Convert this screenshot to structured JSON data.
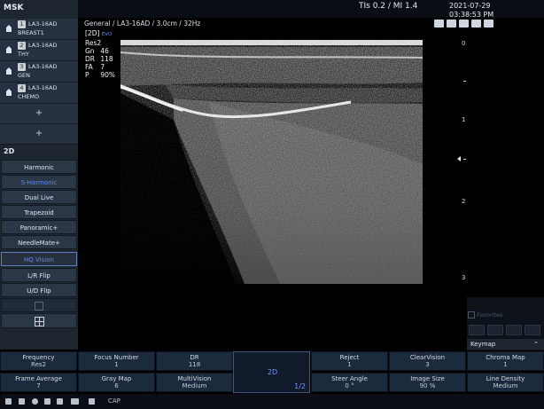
{
  "app_title": "MSK",
  "probes": [
    {
      "num": "1",
      "name": "LA3-16AD",
      "group": "BREAST1"
    },
    {
      "num": "2",
      "name": "LA3-16AD",
      "group": "THY"
    },
    {
      "num": "3",
      "name": "LA3-16AD",
      "group": "GEN"
    },
    {
      "num": "4",
      "name": "LA3-16AD",
      "group": "CHEMO"
    }
  ],
  "plus_label": "+",
  "mode": "2D",
  "mode_buttons": [
    "Harmonic",
    "S-Harmonic",
    "Dual Live",
    "Trapezoid",
    "Panoramic+",
    "NeedleMate+",
    "HQ Vision",
    "L/R Flip",
    "U/D Flip"
  ],
  "status": {
    "index": "TIs 0.2  / MI 1.4",
    "date": "2021-07-29",
    "time": "03:38:53 PM"
  },
  "scan_params": "General / LA3-16AD / 3.0cm / 32Hz",
  "readout": {
    "mode_tag": "[2D]",
    "evo": "EVO",
    "res": "Res2",
    "rows": [
      {
        "k": "Gn",
        "v": "46"
      },
      {
        "k": "DR",
        "v": "118"
      },
      {
        "k": "FA",
        "v": "7"
      },
      {
        "k": "P",
        "v": "90%"
      }
    ]
  },
  "depth_scale": {
    "labels": [
      "0",
      "1",
      "2",
      "3"
    ]
  },
  "favorites_label": "Favorites",
  "keymap_label": "Keymap",
  "bottom_row1": [
    {
      "label": "Frequency",
      "value": "Res2"
    },
    {
      "label": "Focus Number",
      "value": "1"
    },
    {
      "label": "DR",
      "value": "118"
    },
    {
      "label": "Reject",
      "value": "1"
    },
    {
      "label": "ClearVision",
      "value": "3"
    },
    {
      "label": "Chroma Map",
      "value": "1"
    }
  ],
  "bottom_row2": [
    {
      "label": "Frame Average",
      "value": "7"
    },
    {
      "label": "Gray Map",
      "value": "6"
    },
    {
      "label": "MultiVision",
      "value": "Medium"
    },
    {
      "label": "Steer Angle",
      "value": "0 °"
    },
    {
      "label": "Image Size",
      "value": "90 %"
    },
    {
      "label": "Line Density",
      "value": "Medium"
    }
  ],
  "center_cell": {
    "label": "2D",
    "page": "1/2"
  },
  "statusbar_cap": "CAP",
  "colors": {
    "accent": "#5b8cff",
    "panel": "#1e2630",
    "button": "#2b3746",
    "bottom": "#1c2a3d"
  }
}
